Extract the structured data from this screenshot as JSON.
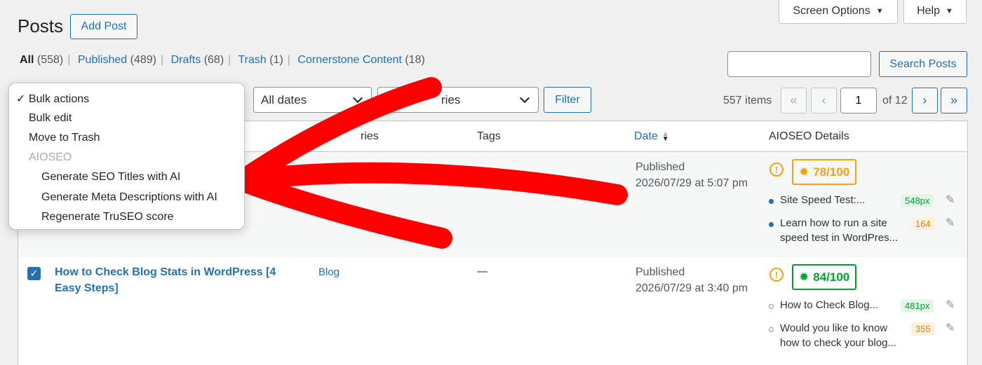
{
  "header": {
    "title": "Posts",
    "add_post": "Add Post",
    "screen_options": "Screen Options",
    "help": "Help"
  },
  "filters": {
    "all_label": "All",
    "all_count": "(558)",
    "published_label": "Published",
    "published_count": "(489)",
    "drafts_label": "Drafts",
    "drafts_count": "(68)",
    "trash_label": "Trash",
    "trash_count": "(1)",
    "cornerstone_label": "Cornerstone Content",
    "cornerstone_count": "(18)"
  },
  "search": {
    "value": "",
    "button": "Search Posts"
  },
  "toolbar": {
    "dates_value": "All dates",
    "categories_value": "ries",
    "filter_button": "Filter"
  },
  "pagination": {
    "items": "557 items",
    "first": "«",
    "prev": "‹",
    "current": "1",
    "of": "of 12",
    "next": "›",
    "last": "»"
  },
  "bulk_menu": {
    "items": [
      {
        "label": "Bulk actions",
        "selected": true
      },
      {
        "label": "Bulk edit"
      },
      {
        "label": "Move to Trash"
      },
      {
        "label": "AIOSEO",
        "group": true
      },
      {
        "label": "Generate SEO Titles with AI"
      },
      {
        "label": "Generate Meta Descriptions with AI"
      },
      {
        "label": "Regenerate TruSEO score"
      }
    ]
  },
  "table": {
    "headers": {
      "categories": "ries",
      "tags": "Tags",
      "date": "Date",
      "aioseo": "AIOSEO Details"
    },
    "rows": [
      {
        "status": "Published",
        "date": "2026/07/29 at 5:07 pm",
        "score": "78/100",
        "title_snippet": "Site Speed Test:...",
        "title_px": "548px",
        "desc_snippet_1": "Learn how to run a site",
        "desc_snippet_2": "speed test in WordPres...",
        "desc_count": "164"
      },
      {
        "title_1": "How to Check Blog Stats in WordPress [4",
        "title_2": "Easy Steps]",
        "category": "Blog",
        "tags": "—",
        "status": "Published",
        "date": "2026/07/29 at 3:40 pm",
        "score": "84/100",
        "title_snippet": "How to Check Blog...",
        "title_px": "481px",
        "desc_snippet_1": "Would you like to know",
        "desc_snippet_2": "how to check your blog...",
        "desc_count": "355"
      }
    ]
  },
  "colors": {
    "accent": "#2271b1",
    "orange": "#f0a21b",
    "green": "#00a32a",
    "arrow": "#ff0000"
  }
}
